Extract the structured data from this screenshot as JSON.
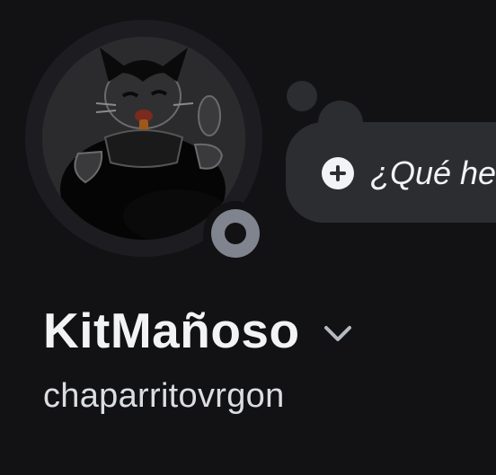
{
  "profile": {
    "display_name": "KitMañoso",
    "username": "chaparritovrgon",
    "avatar_icon": "cartoon-cat-avatar",
    "status_icon": "offline-status-icon",
    "status_color": "#80848e"
  },
  "custom_status": {
    "add_icon": "plus-circle-icon",
    "placeholder": "¿Qué he"
  },
  "chevron_icon": "chevron-down-icon",
  "colors": {
    "background": "#121214",
    "bubble": "#2b2d31",
    "text_primary": "#f2f3f5",
    "text_secondary": "#dbdee1"
  }
}
